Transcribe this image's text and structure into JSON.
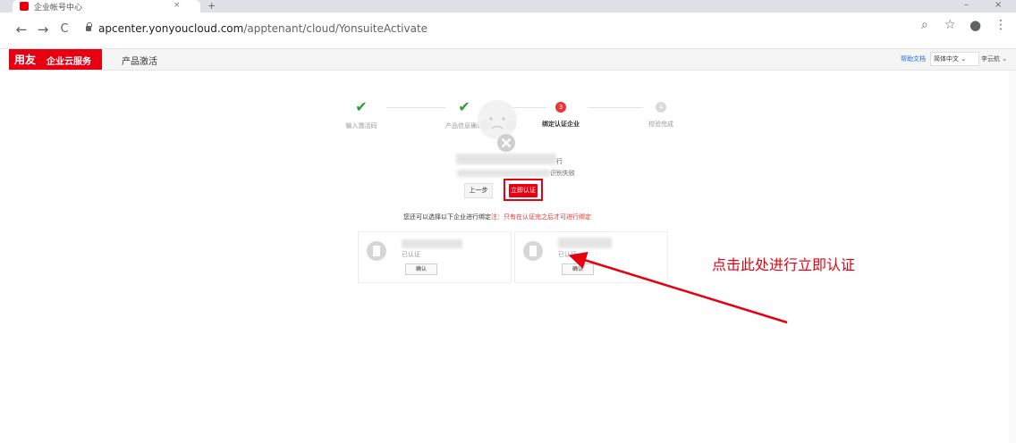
{
  "browser": {
    "tab_title": "企业帐号中心",
    "tab_close": "×",
    "new_tab": "+",
    "address": {
      "host": "apcenter.yonyoucloud.com",
      "path": "/apptenant/cloud/YonsuiteActivate"
    },
    "nav": {
      "back": "←",
      "forward": "→",
      "reload": "C"
    },
    "toolbar_icons": {
      "zoom": "⌕",
      "star": "☆",
      "profile": "●",
      "menu": "⋮"
    },
    "window_controls": {
      "minimize": "–",
      "close": "×"
    }
  },
  "header": {
    "logo_brand": "用友",
    "logo_sub": "企业云服务",
    "app_title": "产品激活",
    "help_link": "帮助文档",
    "language": "简体中文",
    "user": "李云航"
  },
  "steps": [
    {
      "label": "输入激活码",
      "state": "done",
      "icon": "check-icon"
    },
    {
      "label": "产品信息确认",
      "state": "done",
      "icon": "check-icon"
    },
    {
      "label": "绑定认证企业",
      "state": "current",
      "number": "3"
    },
    {
      "label": "校验完成",
      "state": "future",
      "number": "4"
    }
  ],
  "empty_state": {
    "icon": "sad-face-icon",
    "line_suffix": "行",
    "message_end": "识别失败",
    "prev_button": "上一步",
    "verify_button": "立即认证"
  },
  "choose": {
    "text": "您还可以选择以下企业进行绑定",
    "note": "注：只有在认证完之后才可进行绑定"
  },
  "companies": [
    {
      "status": "已认证",
      "bind_button": "确认"
    },
    {
      "status": "已认证",
      "bind_button": "确认"
    }
  ],
  "annotation": {
    "text": "点击此处进行立即认证",
    "color": "#e60012"
  },
  "colors": {
    "brand": "#e60012",
    "success": "#2e9e33",
    "link": "#1e6fd9"
  }
}
